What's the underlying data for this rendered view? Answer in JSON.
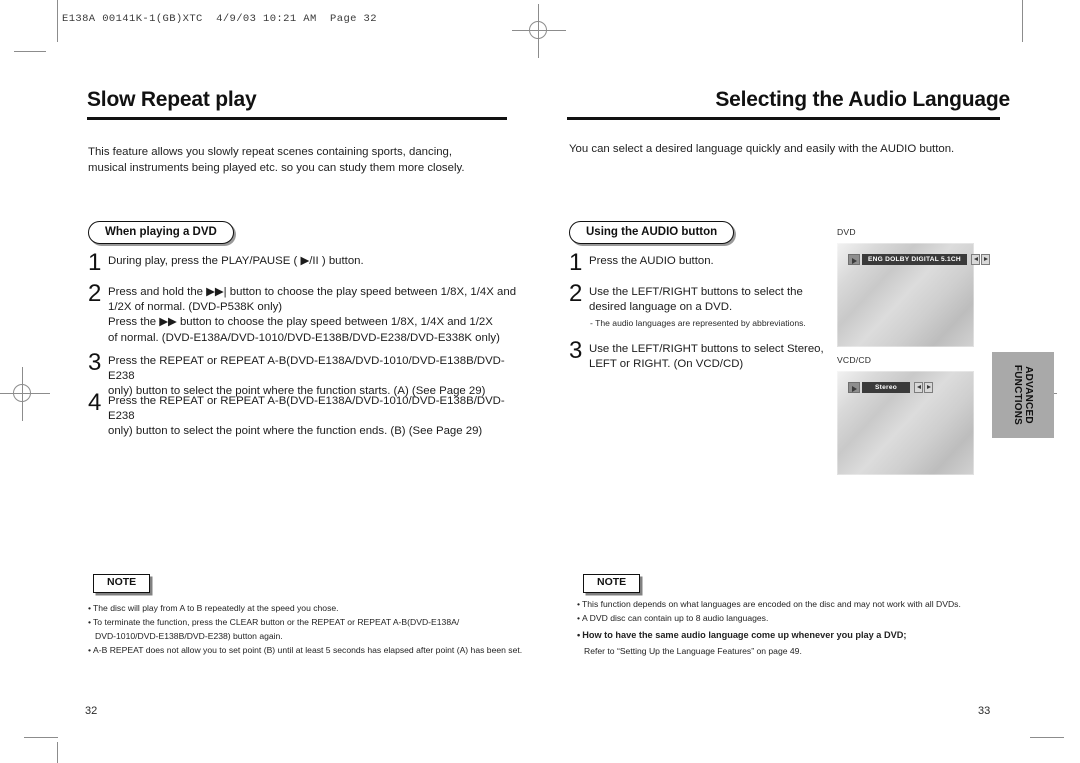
{
  "imposition": {
    "header": "E138A 00141K-1(GB)XTC  4/9/03 10:21 AM  Page 32"
  },
  "left_page": {
    "title": "Slow Repeat play",
    "intro": "This feature allows you slowly repeat scenes containing sports, dancing, musical instruments being played etc. so you can study them more closely.",
    "section_pill": "When playing a DVD",
    "steps": [
      {
        "num": "1",
        "lines": [
          "During play, press the PLAY/PAUSE ( ▶/II ) button."
        ]
      },
      {
        "num": "2",
        "lines": [
          "Press and hold the ▶▶| button to choose the play speed between 1/8X, 1/4X and",
          "1/2X of normal. (DVD-P538K only)",
          "Press the ▶▶ button to choose the play speed between 1/8X, 1/4X and 1/2X",
          "of normal. (DVD-E138A/DVD-1010/DVD-E138B/DVD-E238/DVD-E338K only)"
        ]
      },
      {
        "num": "3",
        "lines": [
          "Press the REPEAT or REPEAT A-B(DVD-E138A/DVD-1010/DVD-E138B/DVD-E238",
          "only) button to select the point where the function starts. (A) (See Page 29)"
        ]
      },
      {
        "num": "4",
        "lines": [
          "Press the REPEAT or REPEAT A-B(DVD-E138A/DVD-1010/DVD-E138B/DVD-E238",
          "only) button to select the point where the function ends. (B) (See Page 29)"
        ]
      }
    ],
    "note_label": "NOTE",
    "notes": [
      {
        "bullet": "•",
        "text": "The disc will play from A to B repeatedly at the speed you chose."
      },
      {
        "bullet": "•",
        "text": "To terminate the function, press the CLEAR button or the REPEAT or REPEAT A-B(DVD-E138A/",
        "cont": "DVD-1010/DVD-E138B/DVD-E238) button again."
      },
      {
        "bullet": "•",
        "text": "A-B REPEAT does not allow you to set point (B) until at least 5 seconds has elapsed after point (A) has been set."
      }
    ],
    "folio": "32"
  },
  "right_page": {
    "title": "Selecting the Audio Language",
    "intro": "You can select a desired language quickly and easily with the AUDIO button.",
    "section_pill": "Using the AUDIO button",
    "steps": [
      {
        "num": "1",
        "lines": [
          "Press the AUDIO button."
        ]
      },
      {
        "num": "2",
        "lines": [
          "Use the LEFT/RIGHT buttons to select the",
          "desired language on a DVD."
        ]
      },
      {
        "num": "3",
        "lines": [
          "Use the LEFT/RIGHT buttons to select Stereo,",
          "LEFT or RIGHT. (On VCD/CD)"
        ]
      }
    ],
    "step2_subnote": "- The audio languages are represented by abbreviations.",
    "screens": [
      {
        "label": "DVD",
        "osd_text": "ENG  DOLBY DIGITAL  5.1CH"
      },
      {
        "label": "VCD/CD",
        "osd_text": "Stereo"
      }
    ],
    "note_label": "NOTE",
    "notes": [
      {
        "bullet": "•",
        "text": "This function depends on what languages are encoded on the disc and may not work with all DVDs.",
        "bold": false
      },
      {
        "bullet": "•",
        "text": "A DVD disc can contain up to 8 audio languages.",
        "bold": false
      },
      {
        "bullet": "•",
        "text": "How to have the same audio language come up whenever you play  a DVD;",
        "bold": true,
        "cont": "Refer to “Setting Up the Language Features” on page 49."
      }
    ],
    "folio": "33"
  },
  "thumb_tab": {
    "line1": "ADVANCED",
    "line2": "FUNCTIONS"
  }
}
